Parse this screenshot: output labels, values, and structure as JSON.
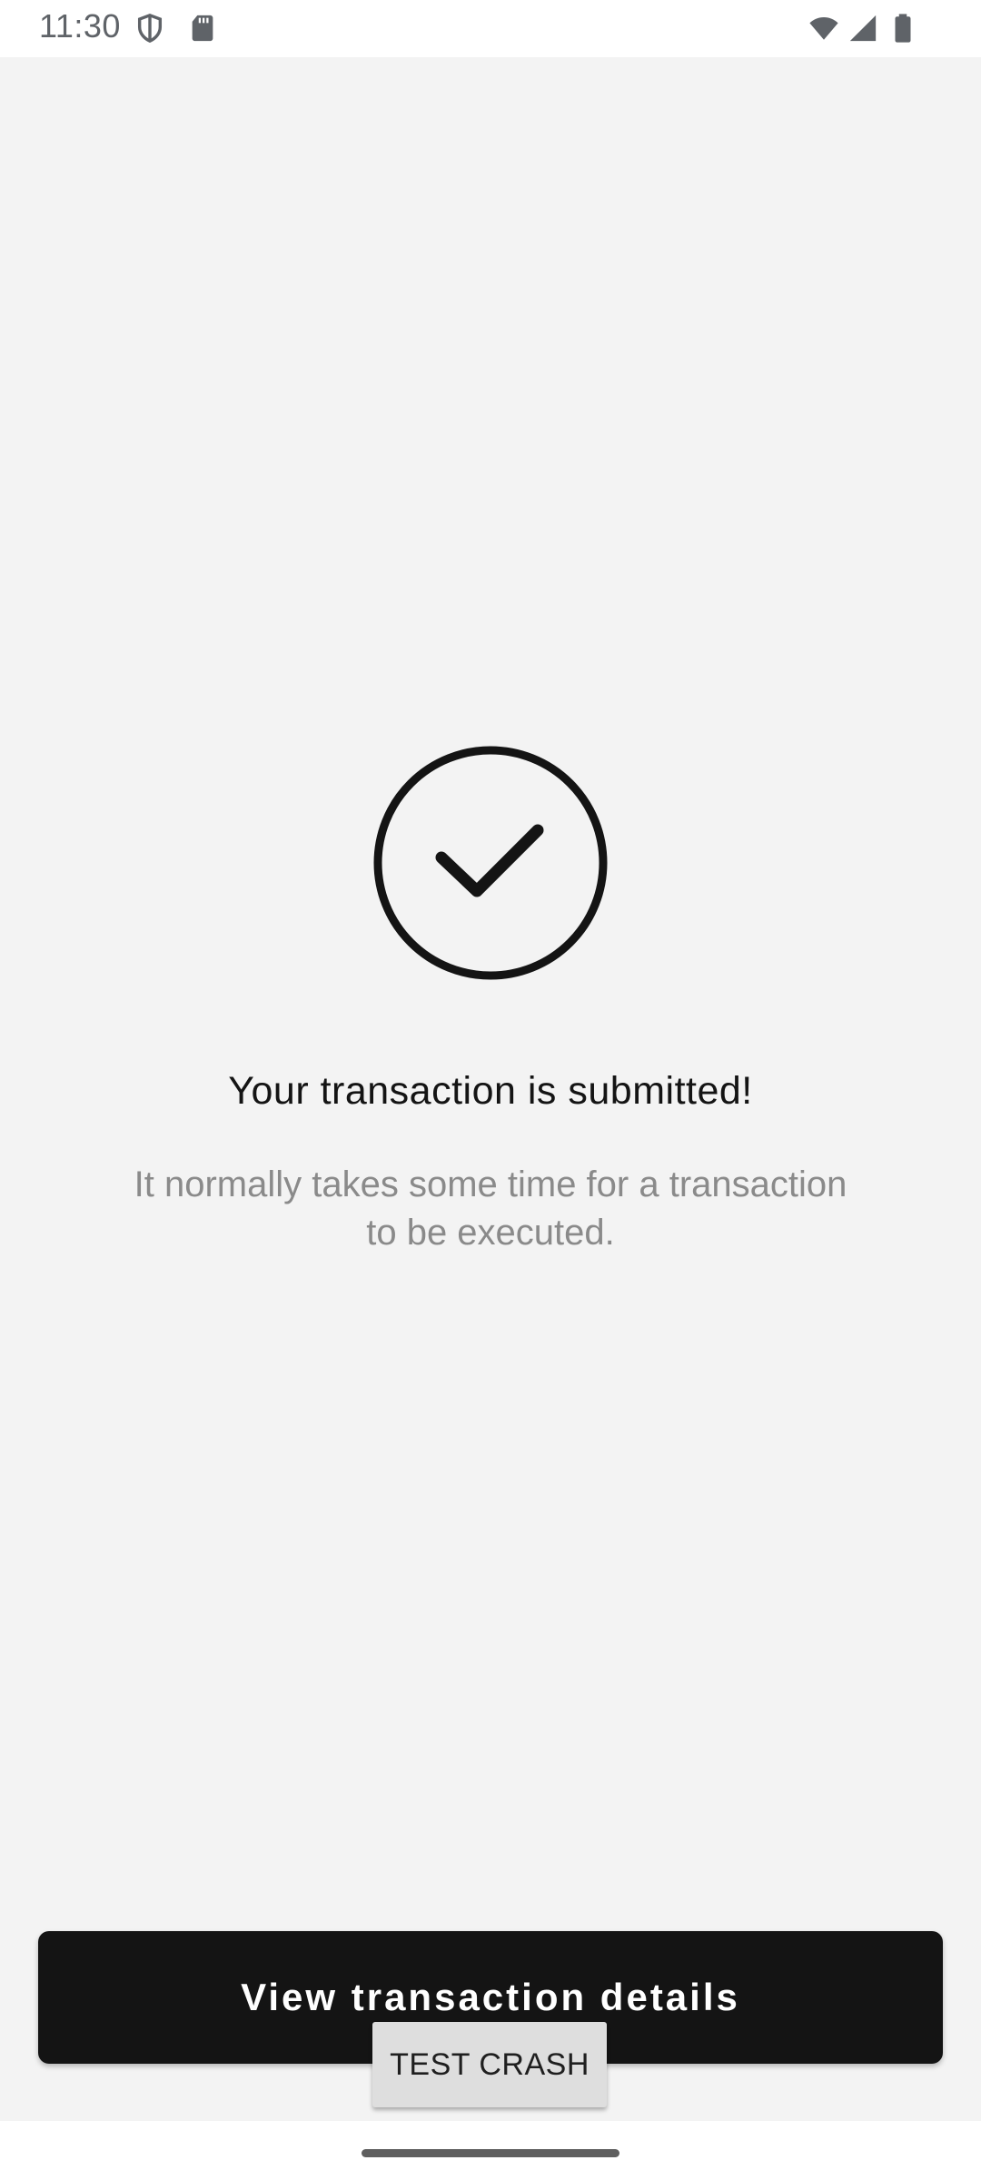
{
  "status_bar": {
    "time": "11:30",
    "icons": [
      "shield-icon",
      "sd-card-icon",
      "wifi-icon",
      "signal-icon",
      "battery-icon"
    ]
  },
  "main": {
    "icon": "check-circle-icon",
    "title": "Your transaction is submitted!",
    "subtitle": "It normally takes some time for a transaction to be executed."
  },
  "actions": {
    "primary_label": "View transaction details",
    "crash_label": "TEST CRASH"
  },
  "colors": {
    "background": "#f3f3f3",
    "primary_button": "#141414",
    "subtitle_text": "#8a8a8a"
  }
}
